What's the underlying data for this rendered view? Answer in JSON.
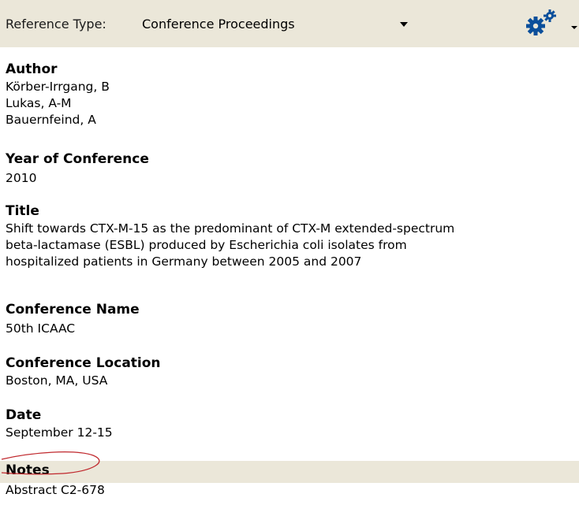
{
  "toolbar": {
    "reference_type_label": "Reference Type:",
    "reference_type_value": "Conference Proceedings",
    "accent_color": "#0b4f9b"
  },
  "fields": {
    "author": {
      "label": "Author",
      "values": [
        "Körber-Irrgang, B",
        "Lukas, A-M",
        "Bauernfeind, A"
      ]
    },
    "year": {
      "label": "Year of Conference",
      "value": "2010"
    },
    "title": {
      "label": "Title",
      "lines": [
        "Shift towards CTX-M-15 as the predominant of CTX-M extended-spectrum",
        "beta-lactamase (ESBL) produced by Escherichia coli isolates from",
        "hospitalized patients in Germany between 2005 and 2007"
      ]
    },
    "conference_name": {
      "label": "Conference Name",
      "value": "50th ICAAC"
    },
    "conference_location": {
      "label": "Conference Location",
      "value": "Boston, MA, USA"
    },
    "date": {
      "label": "Date",
      "value": "September 12-15"
    },
    "notes": {
      "label": "Notes",
      "value": "Abstract C2-678"
    }
  },
  "colors": {
    "toolbar_bg": "#ebe7d9",
    "highlight_circle": "#c0282d"
  }
}
